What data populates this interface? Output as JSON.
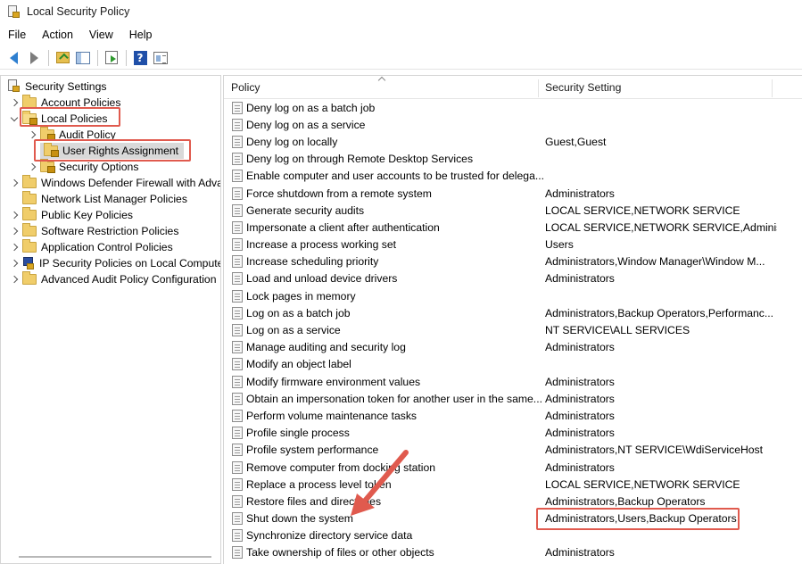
{
  "window": {
    "title": "Local Security Policy"
  },
  "menu": [
    "File",
    "Action",
    "View",
    "Help"
  ],
  "toolbar": {
    "icons": [
      "back-arrow-icon",
      "forward-arrow-icon",
      "up-folder-icon",
      "show-hide-tree-icon",
      "export-list-icon",
      "help-icon",
      "properties-icon"
    ]
  },
  "tree": {
    "root": "Security Settings",
    "items": [
      {
        "label": "Account Policies"
      },
      {
        "label": "Local Policies"
      },
      {
        "label": "Audit Policy"
      },
      {
        "label": "User Rights Assignment"
      },
      {
        "label": "Security Options"
      },
      {
        "label": "Windows Defender Firewall with Adva"
      },
      {
        "label": "Network List Manager Policies"
      },
      {
        "label": "Public Key Policies"
      },
      {
        "label": "Software Restriction Policies"
      },
      {
        "label": "Application Control Policies"
      },
      {
        "label": "IP Security Policies on Local Compute"
      },
      {
        "label": "Advanced Audit Policy Configuration"
      }
    ]
  },
  "list": {
    "columns": {
      "policy": "Policy",
      "setting": "Security Setting"
    },
    "rows": [
      {
        "policy": "Deny log on as a batch job",
        "setting": ""
      },
      {
        "policy": "Deny log on as a service",
        "setting": ""
      },
      {
        "policy": "Deny log on locally",
        "setting": "Guest,Guest"
      },
      {
        "policy": "Deny log on through Remote Desktop Services",
        "setting": ""
      },
      {
        "policy": "Enable computer and user accounts to be trusted for delega...",
        "setting": ""
      },
      {
        "policy": "Force shutdown from a remote system",
        "setting": "Administrators"
      },
      {
        "policy": "Generate security audits",
        "setting": "LOCAL SERVICE,NETWORK SERVICE"
      },
      {
        "policy": "Impersonate a client after authentication",
        "setting": "LOCAL SERVICE,NETWORK SERVICE,Administ..."
      },
      {
        "policy": "Increase a process working set",
        "setting": "Users"
      },
      {
        "policy": "Increase scheduling priority",
        "setting": "Administrators,Window Manager\\Window M..."
      },
      {
        "policy": "Load and unload device drivers",
        "setting": "Administrators"
      },
      {
        "policy": "Lock pages in memory",
        "setting": ""
      },
      {
        "policy": "Log on as a batch job",
        "setting": "Administrators,Backup Operators,Performanc..."
      },
      {
        "policy": "Log on as a service",
        "setting": "NT SERVICE\\ALL SERVICES"
      },
      {
        "policy": "Manage auditing and security log",
        "setting": "Administrators"
      },
      {
        "policy": "Modify an object label",
        "setting": ""
      },
      {
        "policy": "Modify firmware environment values",
        "setting": "Administrators"
      },
      {
        "policy": "Obtain an impersonation token for another user in the same...",
        "setting": "Administrators"
      },
      {
        "policy": "Perform volume maintenance tasks",
        "setting": "Administrators"
      },
      {
        "policy": "Profile single process",
        "setting": "Administrators"
      },
      {
        "policy": "Profile system performance",
        "setting": "Administrators,NT SERVICE\\WdiServiceHost"
      },
      {
        "policy": "Remove computer from docking station",
        "setting": "Administrators"
      },
      {
        "policy": "Replace a process level token",
        "setting": "LOCAL SERVICE,NETWORK SERVICE"
      },
      {
        "policy": "Restore files and directories",
        "setting": "Administrators,Backup Operators"
      },
      {
        "policy": "Shut down the system",
        "setting": "Administrators,Users,Backup Operators"
      },
      {
        "policy": "Synchronize directory service data",
        "setting": ""
      },
      {
        "policy": "Take ownership of files or other objects",
        "setting": "Administrators"
      }
    ]
  },
  "annotation_color": "#e05a4e"
}
